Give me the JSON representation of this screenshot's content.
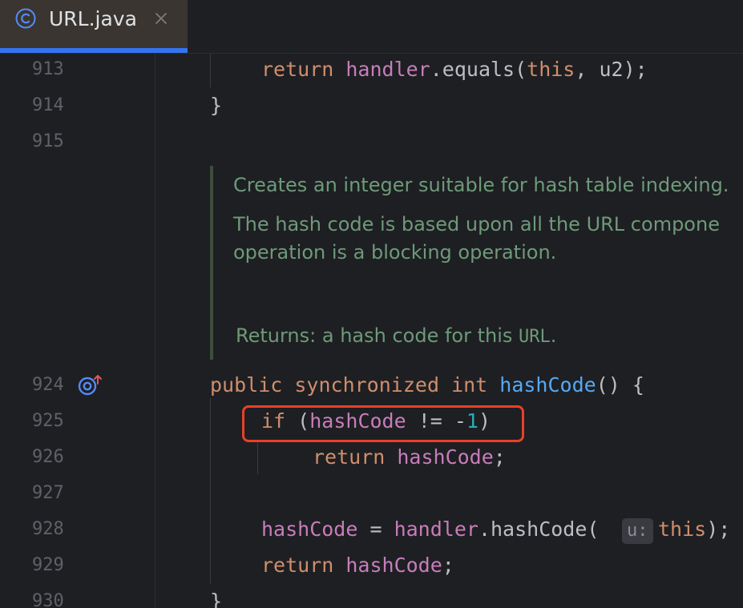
{
  "tab": {
    "icon": "class-c-icon",
    "label": "URL.java",
    "close_icon": "close-icon"
  },
  "colors": {
    "keyword": "#cf8e6d",
    "field": "#c77dbb",
    "method": "#56a8f5",
    "number": "#2aacb8",
    "text": "#bcbec4",
    "doc": "#6d9a7a",
    "highlight_box": "#e8402a",
    "tab_accent": "#3574f0"
  },
  "lines": {
    "913": "913",
    "914": "914",
    "915": "915",
    "924": "924",
    "925": "925",
    "926": "926",
    "927": "927",
    "928": "928",
    "929": "929",
    "930": "930"
  },
  "code": {
    "l913": {
      "kw": "return",
      "field": "handler",
      "rest": ".equals(",
      "kw2": "this",
      "tail": ", u2);"
    },
    "l914": "}",
    "l924": {
      "kw1": "public",
      "kw2": "synchronized",
      "kw3": "int",
      "method": "hashCode",
      "tail": "() {"
    },
    "l925": {
      "kw": "if",
      "open": "(",
      "field": "hashCode",
      "op": " != -",
      "num": "1",
      "close": ")"
    },
    "l926": {
      "kw": "return",
      "field": "hashCode",
      "tail": ";"
    },
    "l928": {
      "field": "hashCode",
      "eq": " = ",
      "field2": "handler",
      "call": ".hashCode(",
      "hint": "u:",
      "kw": "this",
      "tail": ");"
    },
    "l929": {
      "kw": "return",
      "field": "hashCode",
      "tail": ";"
    },
    "l930": "}"
  },
  "doc": {
    "line1": "Creates an integer suitable for hash table indexing.",
    "line2": "The hash code is based upon all the URL compone",
    "line3": "operation is a blocking operation.",
    "returns_prefix": "Returns: a hash code for this ",
    "returns_code": "URL",
    "returns_suffix": "."
  },
  "gutter": {
    "override_icon": "implemented-method-icon"
  }
}
